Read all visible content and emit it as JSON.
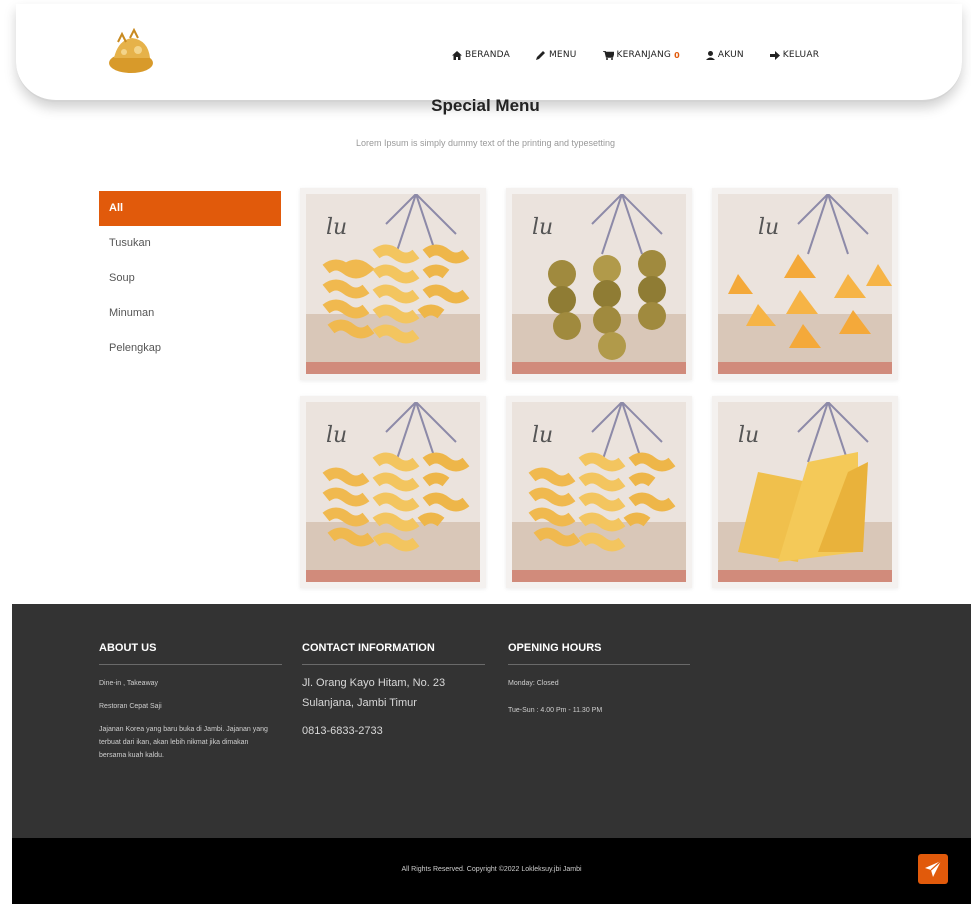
{
  "nav": {
    "items": [
      {
        "label": "BERANDA",
        "icon": "home-icon"
      },
      {
        "label": "MENU",
        "icon": "pencil-icon"
      },
      {
        "label": "KERANJANG",
        "icon": "cart-icon",
        "badge": "0"
      },
      {
        "label": "AKUN",
        "icon": "user-icon"
      },
      {
        "label": "KELUAR",
        "icon": "logout-icon"
      }
    ]
  },
  "section": {
    "title": "Special Menu",
    "subtitle": "Lorem Ipsum is simply dummy text of the printing and typesetting"
  },
  "categories": [
    "All",
    "Tusukan",
    "Soup",
    "Minuman",
    "Pelengkap"
  ],
  "footer": {
    "about": {
      "title": "ABOUT US",
      "lines": [
        "Dine-in , Takeaway",
        "Restoran Cepat Saji",
        "Jajanan Korea yang baru buka di Jambi. Jajanan yang terbuat dari ikan, akan lebih nikmat jika dimakan bersama kuah kaldu."
      ]
    },
    "contact": {
      "title": "CONTACT INFORMATION",
      "address1": "Jl. Orang Kayo Hitam, No. 23",
      "address2": "Sulanjana, Jambi Timur",
      "phone": "0813-6833-2733"
    },
    "hours": {
      "title": "OPENING HOURS",
      "line1": "Monday: Closed",
      "line2": "Tue-Sun : 4.00 Pm - 11.30 PM"
    }
  },
  "copyright": "All Rights Reserved. Copyright ©2022 Lokleksuy.jbi Jambi",
  "colors": {
    "accent": "#e15a0b",
    "footer": "#333333",
    "bottom": "#000000"
  }
}
